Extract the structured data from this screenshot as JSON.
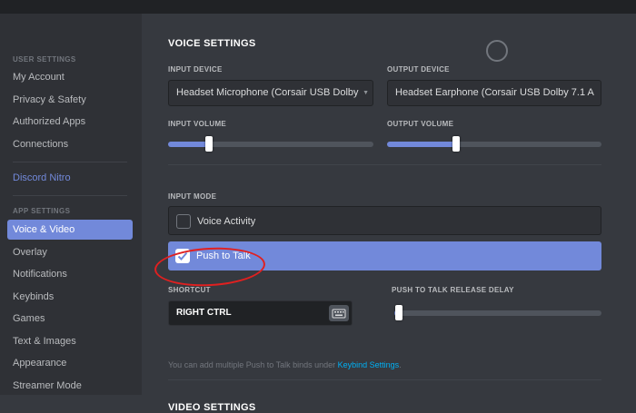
{
  "sidebar": {
    "user_settings_header": "USER SETTINGS",
    "user_items": [
      "My Account",
      "Privacy & Safety",
      "Authorized Apps",
      "Connections"
    ],
    "nitro_label": "Discord Nitro",
    "app_settings_header": "APP SETTINGS",
    "app_items": [
      "Voice & Video",
      "Overlay",
      "Notifications",
      "Keybinds",
      "Games",
      "Text & Images",
      "Appearance",
      "Streamer Mode"
    ],
    "active_item": "Voice & Video"
  },
  "voice": {
    "title": "VOICE SETTINGS",
    "input_device_label": "INPUT DEVICE",
    "input_device_value": "Headset Microphone (Corsair USB Dolby",
    "output_device_label": "OUTPUT DEVICE",
    "output_device_value": "Headset Earphone (Corsair USB Dolby 7.1 A",
    "input_volume_label": "INPUT VOLUME",
    "input_volume_level": 0.2,
    "output_volume_label": "OUTPUT VOLUME",
    "output_volume_level": 0.32,
    "input_mode_label": "INPUT MODE",
    "mode_voice_activity": "Voice Activity",
    "mode_push_to_talk": "Push to Talk",
    "selected_mode": "Push to Talk",
    "shortcut_label": "SHORTCUT",
    "shortcut_value": "RIGHT CTRL",
    "ptt_delay_label": "PUSH TO TALK RELEASE DELAY",
    "ptt_delay_level": 0.02,
    "hint_prefix": "You can add multiple Push to Talk binds under ",
    "hint_link": "Keybind Settings",
    "hint_suffix": "."
  },
  "video": {
    "title": "VIDEO SETTINGS"
  },
  "colors": {
    "accent": "#7289da",
    "link": "#00b0f4",
    "highlight_circle": "#e02020"
  },
  "icons": {
    "keyboard": "keyboard-icon",
    "check": "checkmark-icon",
    "close": "close-icon"
  }
}
